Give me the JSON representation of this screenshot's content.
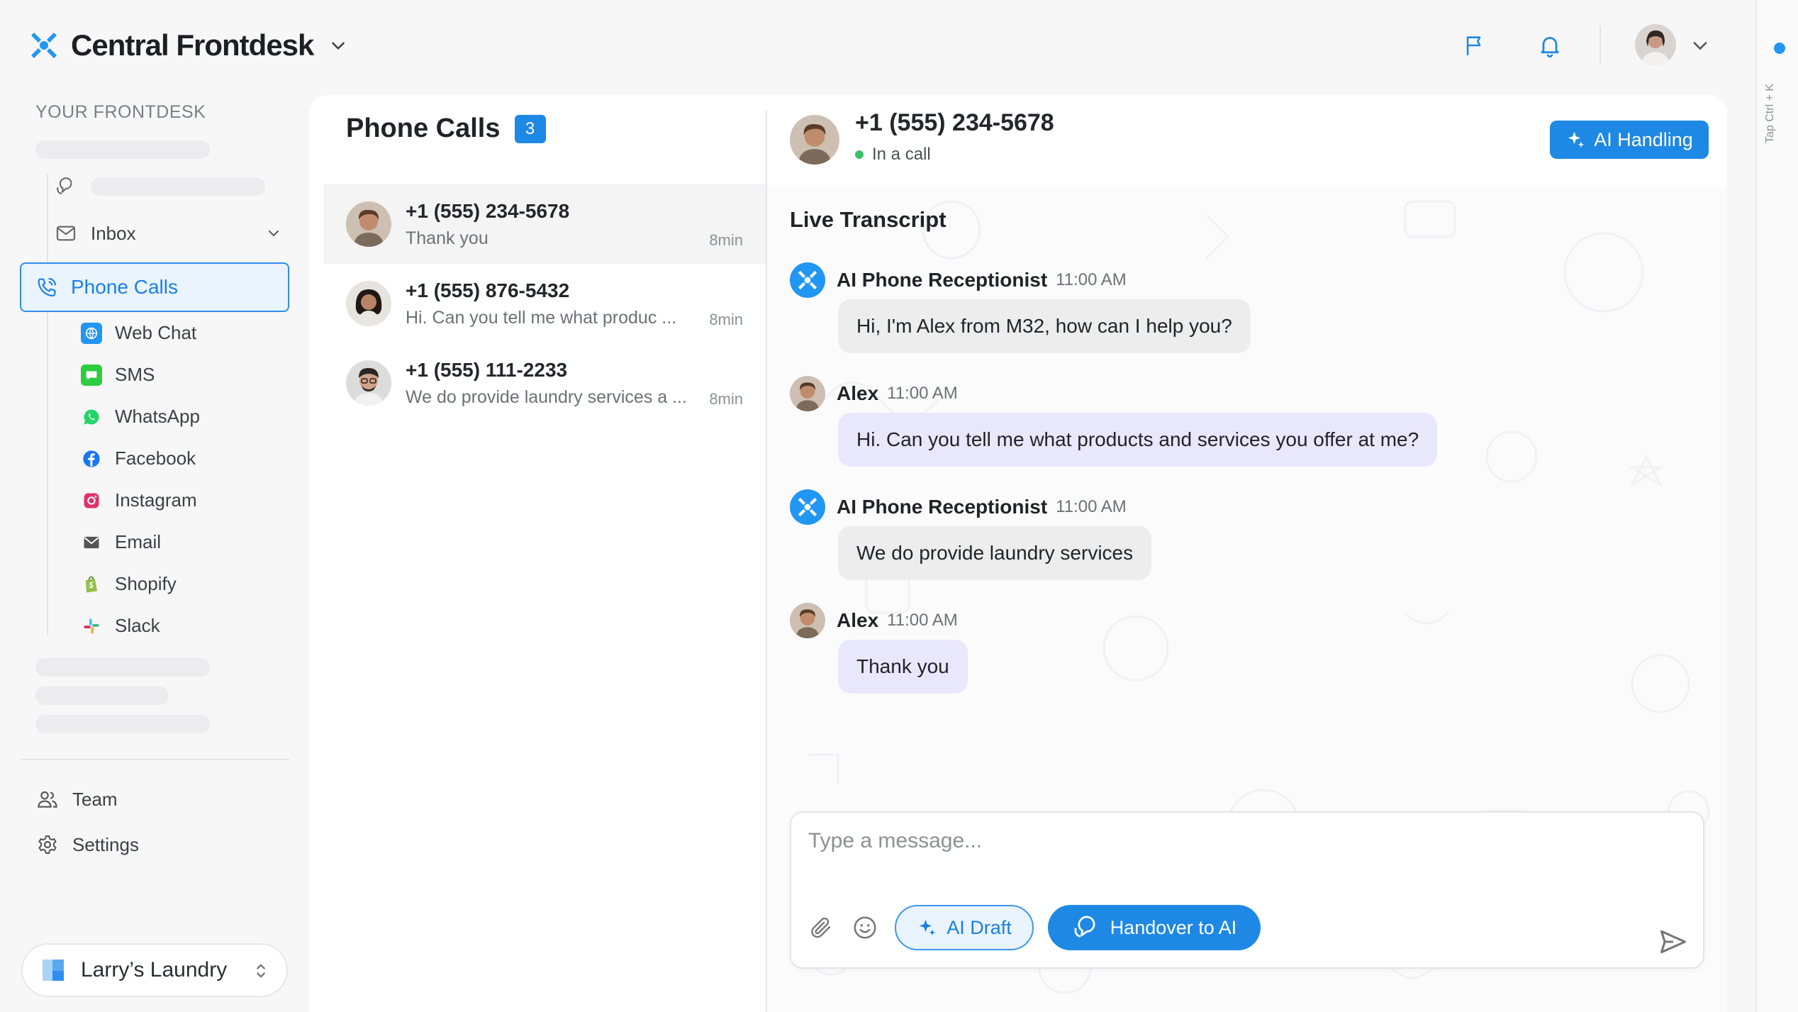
{
  "app": {
    "name": "Central Frontdesk"
  },
  "sidebar": {
    "section_label": "YOUR FRONTDESK",
    "inbox_label": "Inbox",
    "active_label": "Phone Calls",
    "channels": [
      {
        "label": "Web Chat",
        "icon": "web-chat-icon"
      },
      {
        "label": "SMS",
        "icon": "sms-icon"
      },
      {
        "label": "WhatsApp",
        "icon": "whatsapp-icon"
      },
      {
        "label": "Facebook",
        "icon": "facebook-icon"
      },
      {
        "label": "Instagram",
        "icon": "instagram-icon"
      },
      {
        "label": "Email",
        "icon": "email-icon"
      },
      {
        "label": "Shopify",
        "icon": "shopify-icon"
      },
      {
        "label": "Slack",
        "icon": "slack-icon"
      }
    ],
    "team_label": "Team",
    "settings_label": "Settings",
    "workspace_name": "Larry’s Laundry"
  },
  "calls": {
    "title": "Phone Calls",
    "count": "3",
    "items": [
      {
        "number": "+1 (555) 234-5678",
        "preview": "Thank you",
        "time": "8min"
      },
      {
        "number": "+1 (555) 876-5432",
        "preview": "Hi. Can you tell me what produc ...",
        "time": "8min"
      },
      {
        "number": "+1 (555) 111-2233",
        "preview": "We do provide laundry services a ...",
        "time": "8min"
      }
    ]
  },
  "conversation": {
    "number": "+1 (555) 234-5678",
    "status": "In a call",
    "ai_handling_label": "AI Handling",
    "transcript_title": "Live Transcript",
    "messages": [
      {
        "sender": "AI Phone Receptionist",
        "time": "11:00 AM",
        "text": "Hi, I'm Alex from M32, how can I help you?"
      },
      {
        "sender": "Alex",
        "time": "11:00 AM",
        "text": "Hi. Can you tell me what products and services you offer at me?"
      },
      {
        "sender": "AI Phone Receptionist",
        "time": "11:00 AM",
        "text": "We do provide laundry services"
      },
      {
        "sender": "Alex",
        "time": "11:00 AM",
        "text": "Thank you"
      }
    ]
  },
  "composer": {
    "placeholder": "Type a message...",
    "ai_draft_label": "AI Draft",
    "handover_label": "Handover to AI"
  },
  "rail": {
    "hint": "Tap Ctrl + K"
  },
  "colors": {
    "accent": "#1e88e5",
    "user_bubble": "#e9e7fb",
    "ai_bubble": "#ededee",
    "online": "#3bbf6a"
  }
}
